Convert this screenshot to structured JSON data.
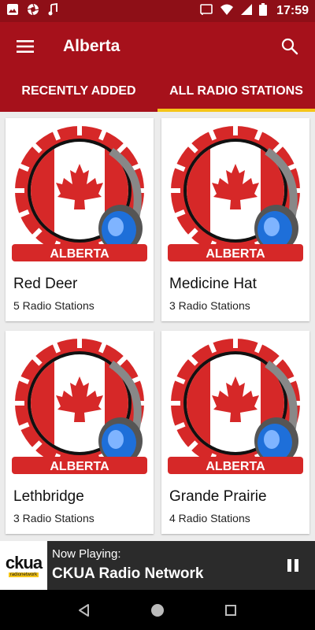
{
  "status_bar": {
    "time": "17:59",
    "left_icons": [
      "image-icon",
      "camera-aperture-icon",
      "music-note-icon"
    ],
    "right_icons": [
      "cast-icon",
      "wifi-icon",
      "signal-icon",
      "battery-icon"
    ]
  },
  "app_bar": {
    "title": "Alberta",
    "menu_icon": "hamburger-menu-icon",
    "search_icon": "search-icon"
  },
  "tabs": [
    {
      "label": "RECENTLY ADDED",
      "active": false
    },
    {
      "label": "ALL RADIO STATIONS",
      "active": true
    }
  ],
  "cards": [
    {
      "city": "Red Deer",
      "count": "5 Radio Stations",
      "banner": "ALBERTA"
    },
    {
      "city": "Medicine Hat",
      "count": "3 Radio Stations",
      "banner": "ALBERTA"
    },
    {
      "city": "Lethbridge",
      "count": "3 Radio Stations",
      "banner": "ALBERTA"
    },
    {
      "city": "Grande Prairie",
      "count": "4 Radio Stations",
      "banner": "ALBERTA"
    }
  ],
  "now_playing": {
    "label": "Now Playing:",
    "station": "CKUA Radio Network",
    "logo_text": "ckua",
    "logo_subtext": "radionetwork"
  },
  "colors": {
    "status_bar": "#8e0f17",
    "app_bar": "#a6111b",
    "tab_indicator": "#f5c518",
    "player_bg": "#2b2b2b"
  }
}
